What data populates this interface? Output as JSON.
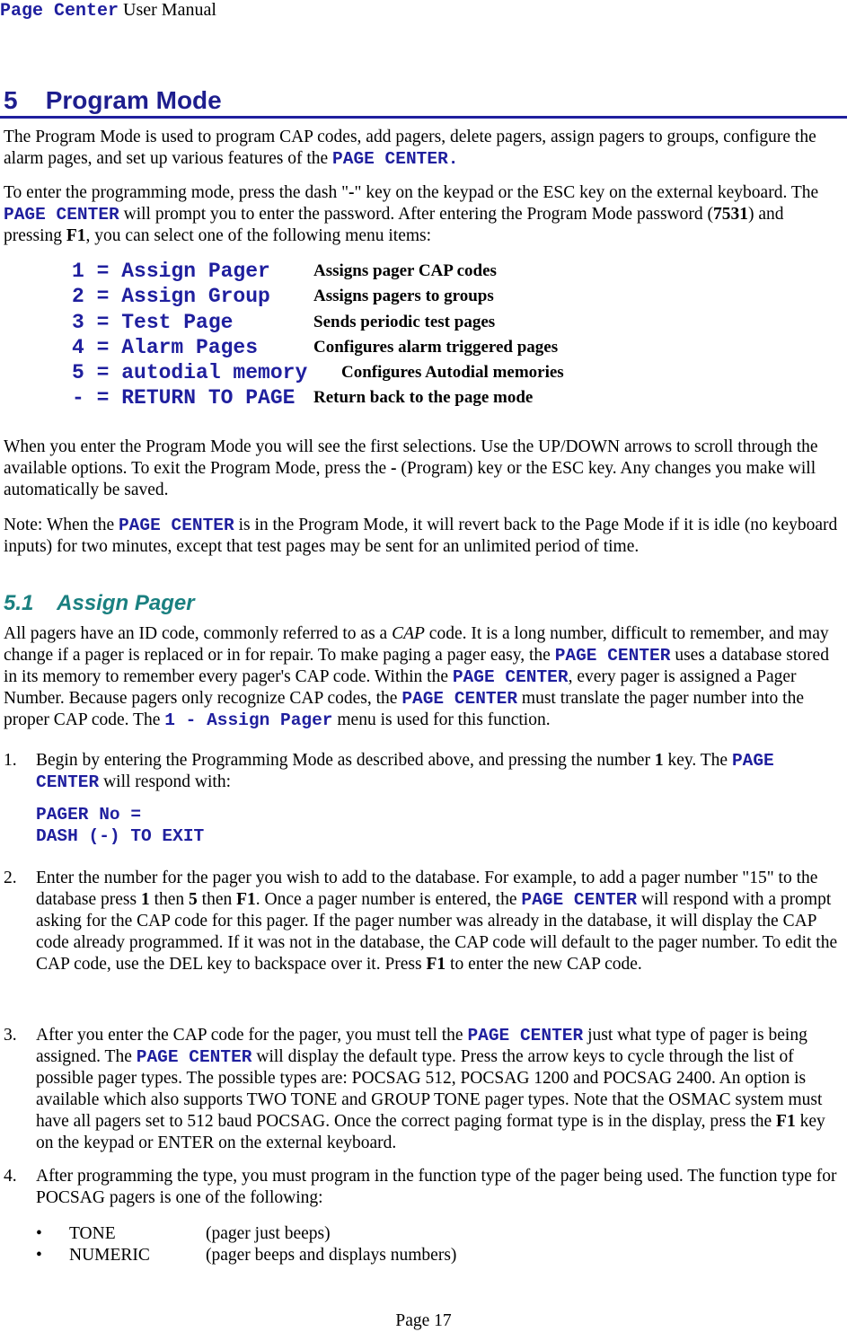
{
  "header": {
    "product": "Page Center",
    "suffix": " User Manual"
  },
  "section": {
    "number": "5",
    "title": "Program Mode"
  },
  "intro": {
    "p1_a": "The Program Mode is used to program CAP codes, add pagers, delete pagers, assign pagers to groups, configure the alarm pages, and set up various features of the ",
    "p1_kw": "PAGE CENTER.",
    "p2_a": "To enter the programming mode, press the dash \"",
    "p2_dash": "-",
    "p2_b": "\" key on the keypad or the ESC key on the external keyboard. The ",
    "p2_kw": "PAGE CENTER",
    "p2_c": " will prompt you to enter the password.  After entering the Program Mode password (",
    "p2_pw": "7531",
    "p2_d": ") and pressing ",
    "p2_f1": "F1",
    "p2_e": ", you can select one of the following menu items:"
  },
  "menu": [
    {
      "key": "1 = Assign Pager",
      "desc": "Assigns pager CAP codes"
    },
    {
      "key": "2 = Assign Group",
      "desc": "Assigns pagers to groups"
    },
    {
      "key": "3 = Test Page",
      "desc": "Sends periodic test pages"
    },
    {
      "key": "4 = Alarm Pages",
      "desc": "Configures alarm triggered pages"
    },
    {
      "key": "5 = autodial memory",
      "desc": "Configures Autodial memories"
    },
    {
      "key": "- = RETURN TO PAGE",
      "desc": "Return back to the page mode"
    }
  ],
  "after_menu": {
    "p3_a": "When you enter the Program Mode you will see the first selections.  Use the UP/DOWN arrows to scroll through the available options.  To exit the Program Mode, press the ",
    "p3_dash": "-",
    "p3_b": " (Program) key or the ESC key.  Any changes you make will automatically be saved.",
    "note_a": "Note: When the ",
    "note_kw": "PAGE CENTER",
    "note_b": " is in the Program Mode, it will revert back to the Page Mode if it is idle (no keyboard inputs) for two minutes, except that test pages may be sent for an unlimited period of time."
  },
  "subsection": {
    "number": "5.1",
    "title": "Assign Pager"
  },
  "assign": {
    "a": "All pagers have an ID code, commonly referred to as a ",
    "cap": "CAP",
    "b": " code.  It is a long number, difficult to remember, and may change if a pager is replaced or in for repair.  To make paging a pager easy, the ",
    "kw1": "PAGE CENTER",
    "c": " uses a database stored in its memory to remember every pager's CAP code.  Within the ",
    "kw2": "PAGE CENTER",
    "d": ", every pager is assigned a Pager Number.  Because pagers only recognize CAP codes, the ",
    "kw3": "PAGE CENTER",
    "e": " must translate the pager number into the proper CAP code.  The ",
    "kw4": "1 - Assign Pager",
    "f": " menu is used for this function."
  },
  "steps": [
    {
      "num": "1.",
      "a": "Begin by entering the Programming Mode as described above, and pressing the number ",
      "b1": "1",
      "b": " key.  The ",
      "kw": "PAGE CENTER",
      "c": " will respond with:"
    },
    {
      "num": "2.",
      "a": "Enter the number for the pager you wish to add to the database.  For example, to add a pager number \"15\" to the database press ",
      "k1": "1",
      "b": " then ",
      "k2": "5",
      "c": " then ",
      "k3": "F1",
      "d": ".  Once a pager number is entered, the ",
      "kw": "PAGE CENTER",
      "e": " will respond with a prompt asking for the CAP code for this pager.   If the pager number was already in the database, it will display the CAP code already programmed.  If it was not in the database, the CAP code will default to the pager number.   To edit the CAP code, use the DEL key to backspace over it.  Press ",
      "k4": "F1",
      "f": " to enter the new CAP code."
    },
    {
      "num": "3.",
      "a": "After you enter the CAP code for the pager, you must tell the ",
      "kw1": "PAGE CENTER",
      "b": " just what type of pager is being assigned.  The ",
      "kw2": "PAGE CENTER",
      "c": " will display the default type.  Press the arrow keys to cycle through the list of possible pager types.  The possible types are: POCSAG 512, POCSAG 1200 and POCSAG 2400. An option is available which also supports TWO TONE and GROUP TONE pager types.  Note that the OSMAC system must have all pagers set to 512 baud POCSAG. Once the correct paging format type is in the display, press the ",
      "k1": "F1",
      "d": " key on the keypad or ENTER on the external keyboard."
    },
    {
      "num": "4.",
      "a": "After programming the type, you must program in the function type of the pager being used.  The function type for POCSAG pagers is one of the following:"
    }
  ],
  "display": {
    "line1": "PAGER No =",
    "line2": "DASH (-) TO EXIT"
  },
  "function_types": [
    {
      "bullet": "•",
      "name": "TONE",
      "desc": "(pager just beeps)"
    },
    {
      "bullet": "•",
      "name": "NUMERIC",
      "desc": "(pager beeps and displays numbers)"
    }
  ],
  "footer": {
    "page": "Page 17"
  }
}
